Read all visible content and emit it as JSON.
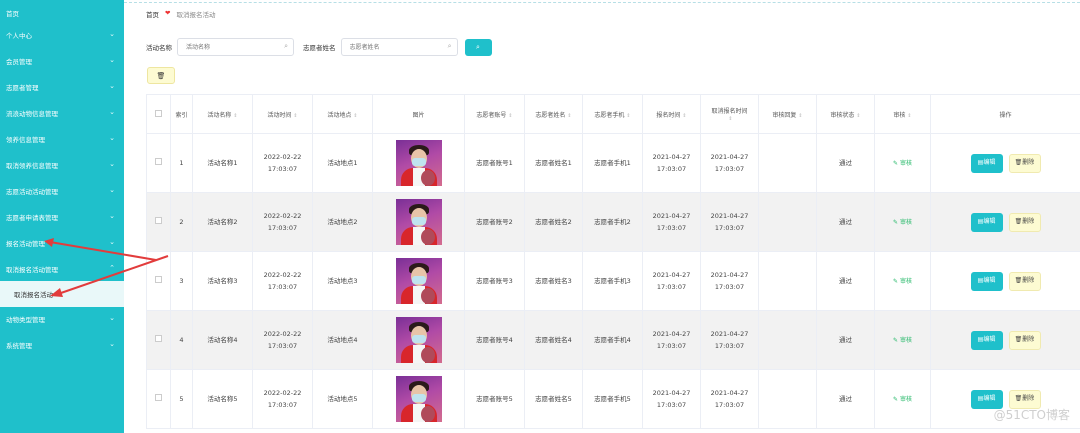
{
  "sidebar": {
    "home": "首页",
    "items": [
      {
        "label": "个人中心"
      },
      {
        "label": "会员管理"
      },
      {
        "label": "志愿者管理"
      },
      {
        "label": "流浪动物信息管理"
      },
      {
        "label": "领养信息管理"
      },
      {
        "label": "取消领养信息管理"
      },
      {
        "label": "志愿活动活动管理"
      },
      {
        "label": "志愿者申请表管理"
      },
      {
        "label": "报名活动管理"
      },
      {
        "label": "取消报名活动管理"
      }
    ],
    "sub_active": "取消报名活动",
    "items_after": [
      {
        "label": "动物类型管理"
      },
      {
        "label": "系统管理"
      }
    ],
    "chevron": "chevron-down-icon"
  },
  "breadcrumb": {
    "home": "首页",
    "heart": "❤",
    "section": "取消报名活动"
  },
  "search": {
    "label1": "活动名称",
    "placeholder1": "活动名称",
    "label2": "志愿者姓名",
    "placeholder2": "志愿者姓名",
    "search_icon": "search-icon"
  },
  "table": {
    "headers": [
      "索引",
      "活动名称",
      "活动时间",
      "活动地点",
      "图片",
      "志愿者账号",
      "志愿者姓名",
      "志愿者手机",
      "报名时间",
      "取消报名时间",
      "审核回复",
      "审核状态",
      "审核",
      "操作"
    ],
    "rows": [
      {
        "idx": "1",
        "name": "活动名称1",
        "time": "2022-02-22 17:03:07",
        "place": "活动地点1",
        "acct": "志愿者账号1",
        "vname": "志愿者姓名1",
        "phone": "志愿者手机1",
        "signup": "2021-04-27 17:03:07",
        "cancel": "2021-04-27 17:03:07",
        "reply": "",
        "status": "通过",
        "review": "审核"
      },
      {
        "idx": "2",
        "name": "活动名称2",
        "time": "2022-02-22 17:03:07",
        "place": "活动地点2",
        "acct": "志愿者账号2",
        "vname": "志愿者姓名2",
        "phone": "志愿者手机2",
        "signup": "2021-04-27 17:03:07",
        "cancel": "2021-04-27 17:03:07",
        "reply": "",
        "status": "通过",
        "review": "审核"
      },
      {
        "idx": "3",
        "name": "活动名称3",
        "time": "2022-02-22 17:03:07",
        "place": "活动地点3",
        "acct": "志愿者账号3",
        "vname": "志愿者姓名3",
        "phone": "志愿者手机3",
        "signup": "2021-04-27 17:03:07",
        "cancel": "2021-04-27 17:03:07",
        "reply": "",
        "status": "通过",
        "review": "审核"
      },
      {
        "idx": "4",
        "name": "活动名称4",
        "time": "2022-02-22 17:03:07",
        "place": "活动地点4",
        "acct": "志愿者账号4",
        "vname": "志愿者姓名4",
        "phone": "志愿者手机4",
        "signup": "2021-04-27 17:03:07",
        "cancel": "2021-04-27 17:03:07",
        "reply": "",
        "status": "通过",
        "review": "审核"
      },
      {
        "idx": "5",
        "name": "活动名称5",
        "time": "2022-02-22 17:03:07",
        "place": "活动地点5",
        "acct": "志愿者账号5",
        "vname": "志愿者姓名5",
        "phone": "志愿者手机5",
        "signup": "2021-04-27 17:03:07",
        "cancel": "2021-04-27 17:03:07",
        "reply": "",
        "status": "通过",
        "review": "审核"
      }
    ],
    "edit_label": "编辑",
    "delete_label": "删除"
  },
  "watermark": "@51CTO博客",
  "colors": {
    "accent": "#1fc0cb",
    "delete_bg": "#fdfbd2",
    "review_green": "#27b96a",
    "arrow_red": "#e23c3c"
  }
}
